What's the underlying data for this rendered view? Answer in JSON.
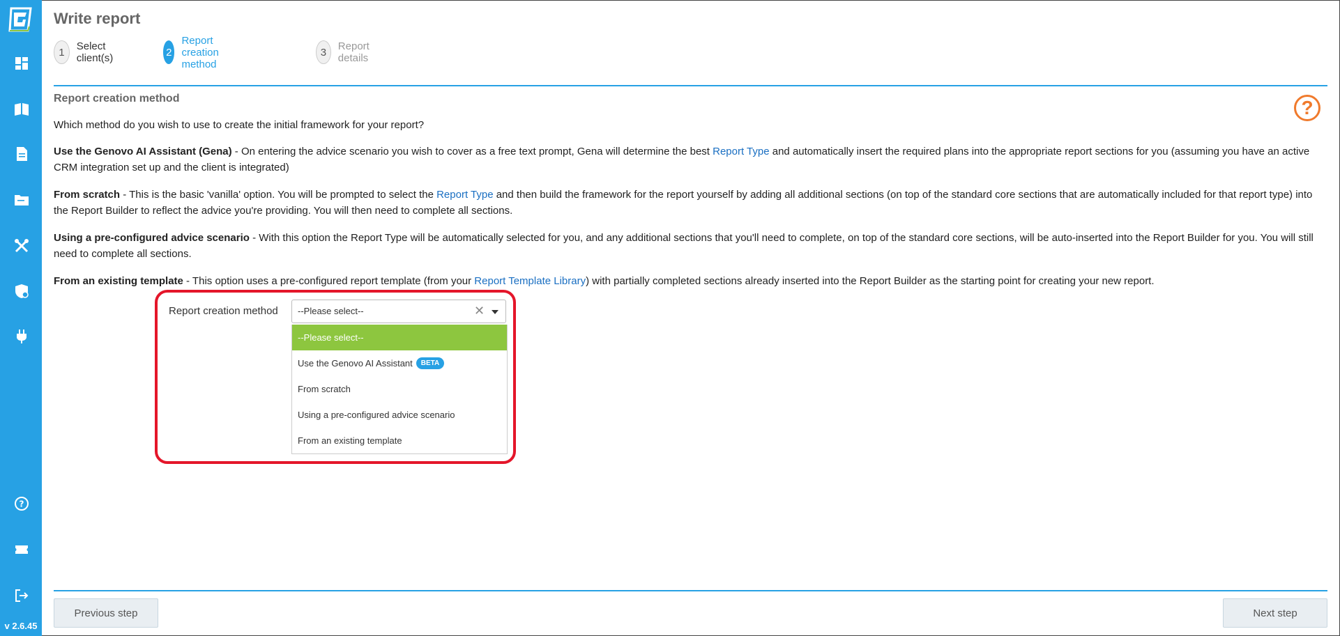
{
  "app": {
    "version": "v 2.6.45",
    "colors": {
      "sidebar": "#27a1e4",
      "accent": "#27a1e4",
      "selected_option": "#8dc63f",
      "highlight": "#e4162a",
      "help": "#f07a2c"
    }
  },
  "sidebar": {
    "icons": [
      "logo-icon",
      "dashboard-icon",
      "book-icon",
      "document-icon",
      "folder-icon",
      "tools-icon",
      "shield-icon",
      "plug-icon",
      "help-icon",
      "ticket-icon",
      "logout-icon"
    ]
  },
  "header": {
    "title": "Write report",
    "steps": [
      {
        "num": "1",
        "label": "Select client(s)"
      },
      {
        "num": "2",
        "label": "Report creation method"
      },
      {
        "num": "3",
        "label": "Report details"
      }
    ]
  },
  "content": {
    "section_title": "Report creation method",
    "help_symbol": "?",
    "intro": "Which method do you wish to use to create the initial framework for your report?",
    "gena": {
      "title": "Use the Genovo AI Assistant (Gena)",
      "text1": " - On entering the advice scenario you wish to cover as a free text prompt, Gena will determine the best ",
      "link": "Report Type",
      "text2": " and automatically insert the required plans into the appropriate report sections for you (assuming you have an active CRM integration set up and the client is integrated)"
    },
    "scratch": {
      "title": "From scratch",
      "text1": " - This is the basic 'vanilla' option. You will be prompted to select the ",
      "link": "Report Type",
      "text2": " and then build the framework for the report yourself by adding all additional sections (on top of the standard core sections that are automatically included for that report type) into the Report Builder to reflect the advice you're providing. You will then need to complete all sections."
    },
    "preconfig": {
      "title": "Using a pre-configured advice scenario",
      "text1": " - With this option the Report Type will be automatically selected for you, and any additional sections that you'll need to complete, on top of the standard core sections, will be auto-inserted into the Report Builder for you. You will still need to complete all sections."
    },
    "template": {
      "title": "From an existing template",
      "text1": " - This option uses a pre-configured report template (from your ",
      "link": "Report Template Library",
      "text2": ") with partially completed sections already inserted into the Report Builder as the starting point for creating your new report."
    }
  },
  "form": {
    "label": "Report creation method",
    "select_value": "--Please select--",
    "clear_symbol": "✕",
    "options": [
      {
        "label": "--Please select--"
      },
      {
        "label": "Use the Genovo AI Assistant",
        "badge": "BETA"
      },
      {
        "label": "From scratch"
      },
      {
        "label": "Using a pre-configured advice scenario"
      },
      {
        "label": "From an existing template"
      }
    ]
  },
  "footer": {
    "previous": "Previous step",
    "next": "Next step"
  }
}
